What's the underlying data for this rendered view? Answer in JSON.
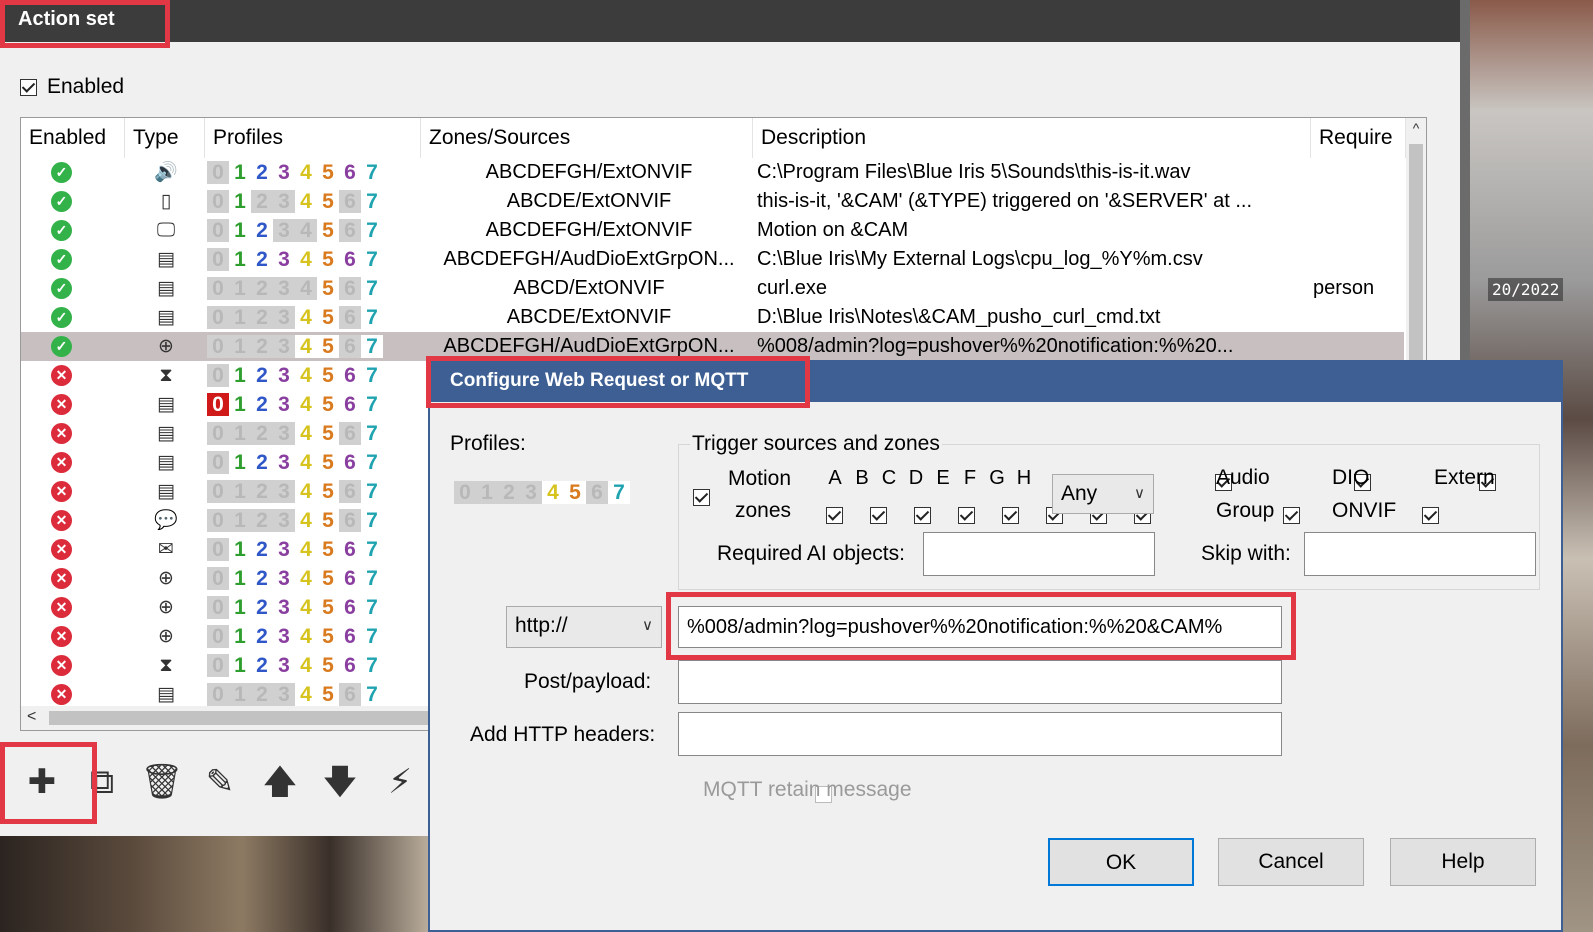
{
  "action_set": {
    "title": "Action set",
    "enabled_label": "Enabled",
    "enabled_checked": true,
    "columns": [
      "Enabled",
      "Type",
      "Profiles",
      "Zones/Sources",
      "Description",
      "Require"
    ],
    "rows": [
      {
        "status": "ok",
        "type": "speaker-icon",
        "profiles": "active",
        "zones": "ABCDEFGH/ExtONVIF",
        "description": "C:\\Program Files\\Blue Iris 5\\Sounds\\this-is-it.wav",
        "require": ""
      },
      {
        "status": "ok",
        "type": "phone-icon",
        "profiles": "alt",
        "zones": "ABCDE/ExtONVIF",
        "description": "this-is-it, '&CAM' (&TYPE) triggered on '&SERVER' at ...",
        "require": ""
      },
      {
        "status": "ok",
        "type": "monitor-icon",
        "profiles": "partial",
        "zones": "ABCDEFGH/ExtONVIF",
        "description": "Motion on &CAM",
        "require": ""
      },
      {
        "status": "ok",
        "type": "document-icon",
        "profiles": "active",
        "zones": "ABCDEFGH/AudDioExtGrpON...",
        "description": "C:\\Blue Iris\\My External Logs\\cpu_log_%Y%m.csv",
        "require": ""
      },
      {
        "status": "ok",
        "type": "document-icon",
        "profiles": "five",
        "zones": "ABCD/ExtONVIF",
        "description": "curl.exe",
        "require": "person"
      },
      {
        "status": "ok",
        "type": "document-icon",
        "profiles": "fourfive",
        "zones": "ABCDE/ExtONVIF",
        "description": "D:\\Blue Iris\\Notes\\&CAM_pusho_curl_cmd.txt",
        "require": ""
      },
      {
        "status": "ok",
        "type": "globe-icon",
        "profiles": "fourfive",
        "zones": "ABCDEFGH/AudDioExtGrpON...",
        "description": "%008/admin?log=pushover%%20notification:%%20...",
        "require": "",
        "selected": true
      },
      {
        "status": "err",
        "type": "hourglass-icon",
        "profiles": "active",
        "zones": "",
        "description": "",
        "require": ""
      },
      {
        "status": "err",
        "type": "document-icon",
        "profiles": "zero",
        "zones": "",
        "description": "",
        "require": ""
      },
      {
        "status": "err",
        "type": "document-icon",
        "profiles": "fourfive",
        "zones": "",
        "description": "",
        "require": ""
      },
      {
        "status": "err",
        "type": "document-icon",
        "profiles": "active",
        "zones": "",
        "description": "",
        "require": ""
      },
      {
        "status": "err",
        "type": "document-icon",
        "profiles": "fourfive",
        "zones": "",
        "description": "",
        "require": ""
      },
      {
        "status": "err",
        "type": "chat-icon",
        "profiles": "fourfive",
        "zones": "",
        "description": "",
        "require": ""
      },
      {
        "status": "err",
        "type": "mail-icon",
        "profiles": "active",
        "zones": "",
        "description": "",
        "require": ""
      },
      {
        "status": "err",
        "type": "globe-icon",
        "profiles": "active",
        "zones": "",
        "description": "",
        "require": ""
      },
      {
        "status": "err",
        "type": "globe-icon",
        "profiles": "active",
        "zones": "",
        "description": "",
        "require": ""
      },
      {
        "status": "err",
        "type": "globe-icon",
        "profiles": "active",
        "zones": "",
        "description": "",
        "require": ""
      },
      {
        "status": "err",
        "type": "hourglass-icon",
        "profiles": "active",
        "zones": "",
        "description": "",
        "require": ""
      },
      {
        "status": "err",
        "type": "document-icon",
        "profiles": "fourfive",
        "zones": "",
        "description": "",
        "require": ""
      }
    ],
    "profile_digits": [
      "0",
      "1",
      "2",
      "3",
      "4",
      "5",
      "6",
      "7"
    ],
    "profile_colors": [
      "#888888",
      "#2e9e2e",
      "#2f57c8",
      "#8a3fa0",
      "#d6c31d",
      "#d97a1e",
      "#8a3fa0",
      "#1fa3b0"
    ],
    "toolbar": [
      "add-icon",
      "copy-icon",
      "trash-icon",
      "edit-icon",
      "arrow-up-icon",
      "arrow-down-icon",
      "lightning-icon"
    ]
  },
  "dialog": {
    "title": "Configure Web Request or MQTT",
    "profiles_label": "Profiles:",
    "profiles_pattern": "fourfive",
    "trigger_group_label": "Trigger sources and zones",
    "motion_label_1": "Motion",
    "motion_label_2": "zones",
    "zone_letters": [
      "A",
      "B",
      "C",
      "D",
      "E",
      "F",
      "G",
      "H"
    ],
    "zones_select": "Any",
    "sources": {
      "audio": "Audio",
      "dio": "DIO",
      "extern": "Extern",
      "group": "Group",
      "onvif": "ONVIF"
    },
    "required_ai_label": "Required AI objects:",
    "required_ai_value": "",
    "skip_with_label": "Skip with:",
    "skip_with_value": "",
    "protocol": "http://",
    "url": "%008/admin?log=pushover%%20notification:%%20&CAM%",
    "post_payload_label": "Post/payload:",
    "post_payload_value": "",
    "http_headers_label": "Add HTTP headers:",
    "http_headers_value": "",
    "mqtt_retain_label": "MQTT retain message",
    "ok": "OK",
    "cancel": "Cancel",
    "help": "Help"
  },
  "background": {
    "timestamp_fragment": "20/2022"
  }
}
